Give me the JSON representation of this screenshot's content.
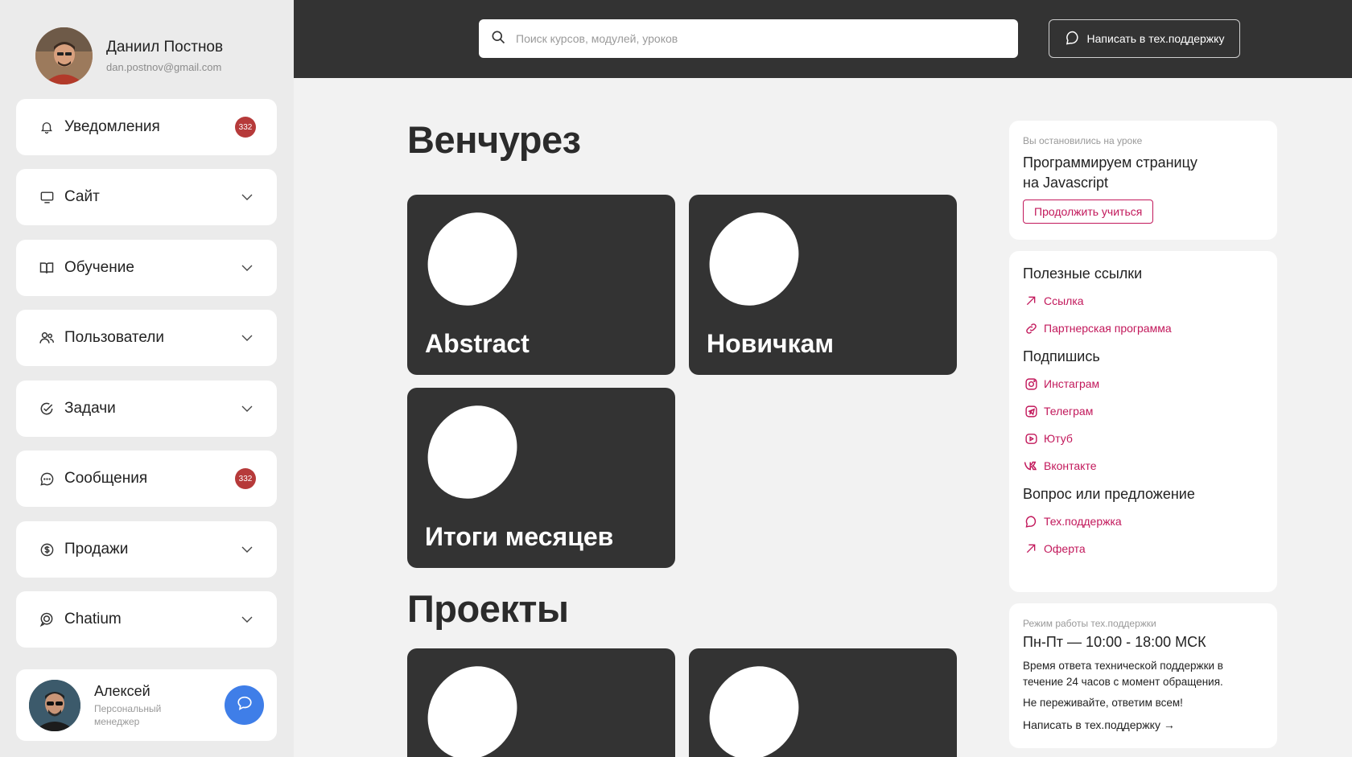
{
  "profile": {
    "name": "Даниил Постнов",
    "email": "dan.postnov@gmail.com"
  },
  "nav": {
    "notifications": {
      "label": "Уведомления",
      "badge": "332",
      "icon": "bell-icon"
    },
    "site": {
      "label": "Сайт",
      "icon": "monitor-icon"
    },
    "learning": {
      "label": "Обучение",
      "icon": "book-icon"
    },
    "users": {
      "label": "Пользователи",
      "icon": "users-icon"
    },
    "tasks": {
      "label": "Задачи",
      "icon": "tasks-icon"
    },
    "messages": {
      "label": "Сообщения",
      "badge": "332",
      "icon": "chat-icon"
    },
    "sales": {
      "label": "Продажи",
      "icon": "dollar-icon"
    },
    "chatium": {
      "label": "Chatium",
      "icon": "chatium-icon"
    }
  },
  "manager": {
    "name": "Алексей",
    "role": "Персональный менеджер"
  },
  "search": {
    "placeholder": "Поиск курсов, модулей, уроков"
  },
  "topbar": {
    "support_label": "Написать в тех.поддержку"
  },
  "main": {
    "section1_title": "Венчурез",
    "section2_title": "Проекты",
    "cards": [
      "Abstract",
      "Новичкам",
      "Итоги месяцев"
    ]
  },
  "resume": {
    "caption": "Вы остановились на уроке",
    "lesson_line1": "Программируем страницу",
    "lesson_line2": "на Javascript",
    "button": "Продолжить учиться"
  },
  "links": {
    "useful_title": "Полезные ссылки",
    "useful": [
      "Ссылка",
      "Партнерская программа"
    ],
    "subscribe_title": "Подпишись",
    "subscribe": [
      "Инстаграм",
      "Телеграм",
      "Ютуб",
      "Вконтакте"
    ],
    "question_title": "Вопрос или предложение",
    "question": [
      "Тех.поддержка",
      "Оферта"
    ]
  },
  "support_hours": {
    "caption": "Режим работы тех.поддержки",
    "hours": "Пн-Пт — 10:00 - 18:00 МСК",
    "text1": "Время ответа технической поддержки в течение 24 часов с момент обращения.",
    "text2": "Не переживайте, ответим всем!",
    "link": "Написать в тех.поддержку →"
  },
  "colors": {
    "accent": "#c2185b",
    "dark": "#333333",
    "badge": "#b63a3a",
    "chat_button": "#3f7ee8"
  }
}
